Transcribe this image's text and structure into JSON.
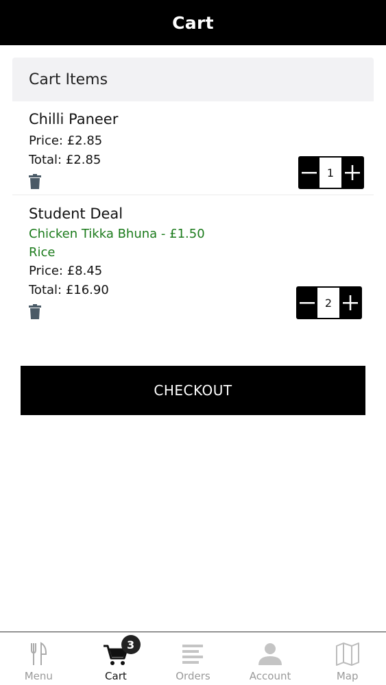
{
  "header": {
    "title": "Cart"
  },
  "cart": {
    "heading": "Cart Items",
    "items": [
      {
        "name": "Chilli Paneer",
        "price": "Price: £2.85",
        "total": "Total: £2.85",
        "quantity": "1"
      },
      {
        "name": "Student Deal",
        "options": [
          "Chicken Tikka Bhuna - £1.50",
          "Rice"
        ],
        "price": "Price: £8.45",
        "total": "Total: £16.90",
        "quantity": "2"
      }
    ],
    "checkout_label": "CHECKOUT"
  },
  "tabbar": {
    "tabs": [
      {
        "label": "Menu",
        "icon": "cutlery-icon"
      },
      {
        "label": "Cart",
        "icon": "cart-icon",
        "badge": "3"
      },
      {
        "label": "Orders",
        "icon": "list-icon"
      },
      {
        "label": "Account",
        "icon": "user-icon"
      },
      {
        "label": "Map",
        "icon": "map-icon"
      }
    ]
  },
  "colors": {
    "option_text": "#1a7a1a",
    "trash_icon": "#4a5a66",
    "inactive_tab": "#999999"
  }
}
